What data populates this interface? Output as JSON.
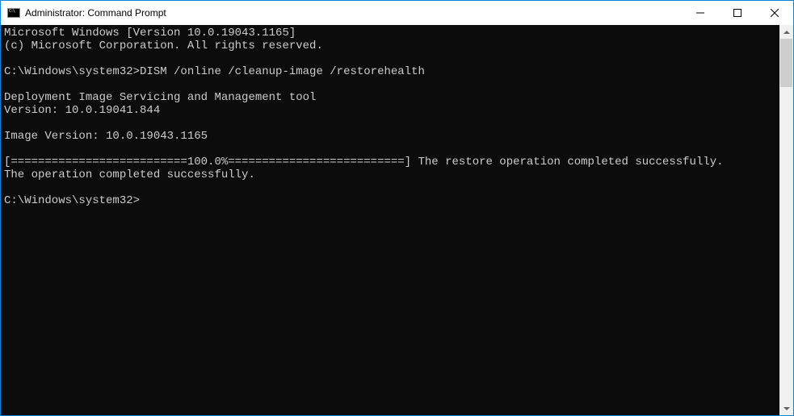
{
  "window": {
    "title": "Administrator: Command Prompt"
  },
  "terminal": {
    "lines": [
      "Microsoft Windows [Version 10.0.19043.1165]",
      "(c) Microsoft Corporation. All rights reserved.",
      "",
      "C:\\Windows\\system32>DISM /online /cleanup-image /restorehealth",
      "",
      "Deployment Image Servicing and Management tool",
      "Version: 10.0.19041.844",
      "",
      "Image Version: 10.0.19043.1165",
      "",
      "[==========================100.0%==========================] The restore operation completed successfully.",
      "The operation completed successfully.",
      "",
      "C:\\Windows\\system32>"
    ]
  }
}
